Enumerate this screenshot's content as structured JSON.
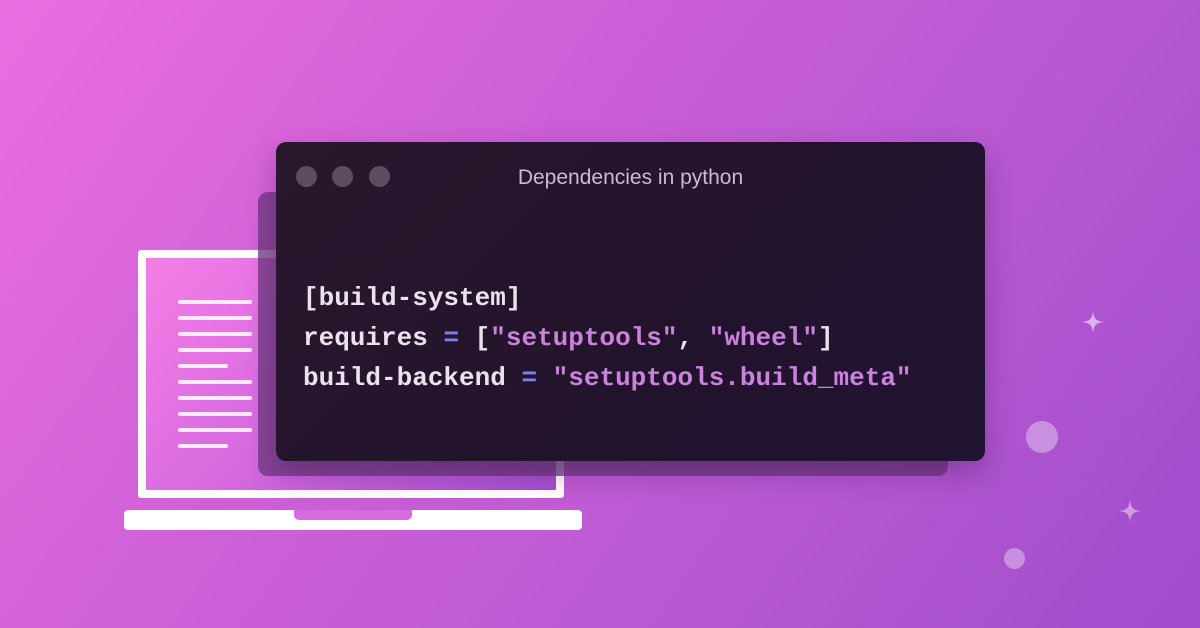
{
  "window": {
    "title": "Dependencies in python"
  },
  "code": {
    "line1": "[build-system]",
    "line2_key": "requires",
    "line2_op": "=",
    "line2_open": "[",
    "line2_str1": "\"setuptools\"",
    "line2_comma": ",",
    "line2_str2": "\"wheel\"",
    "line2_close": "]",
    "line3_key": "build-backend",
    "line3_op": "=",
    "line3_str": "\"setuptools.build_meta\""
  },
  "colors": {
    "background_start": "#ea6ee0",
    "background_end": "#a04ccc",
    "window_bg": "#22132c",
    "operator": "#7f7ff0",
    "string": "#ca82dc",
    "code_text": "#ece2ee"
  },
  "icons": [
    "laptop-icon",
    "document-lines-icon",
    "sparkle-icon",
    "window-control-dots"
  ]
}
